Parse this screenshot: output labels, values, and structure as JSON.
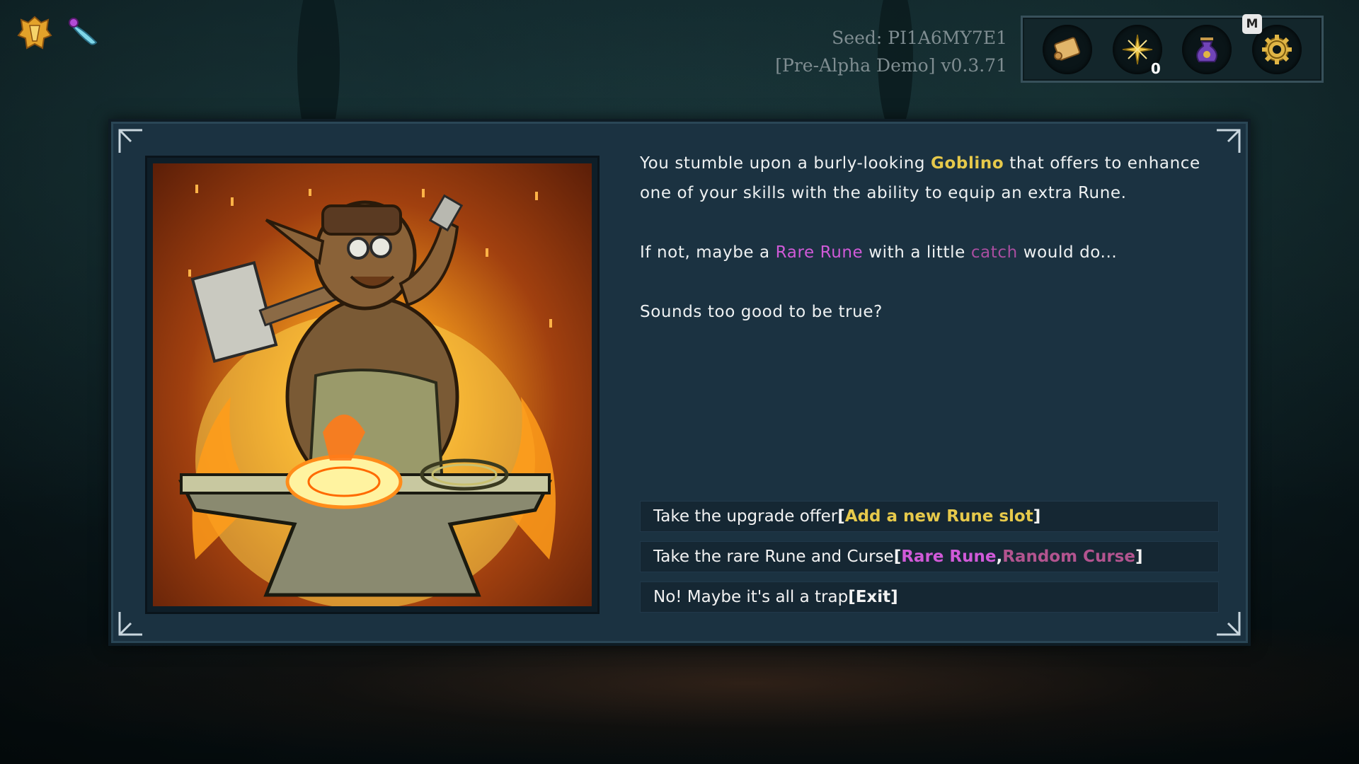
{
  "seed": {
    "seed_label": "Seed: PI1A6MY7E1",
    "version_label": "[Pre-Alpha Demo] v0.3.71"
  },
  "hud": {
    "crest_icon": "golden-crest-icon",
    "weapon_icon": "spirit-dagger-icon"
  },
  "top_menu": {
    "items": [
      {
        "name": "map-scroll-icon"
      },
      {
        "name": "star-points-icon",
        "count": "0"
      },
      {
        "name": "loot-bag-icon"
      },
      {
        "name": "settings-gear-icon"
      }
    ],
    "hotkey": "M"
  },
  "event": {
    "paragraph1": {
      "pre": "You stumble upon a burly-looking ",
      "name": "Goblino",
      "post": " that offers to enhance one of your skills with the ability to equip an extra Rune."
    },
    "paragraph2": {
      "pre": "If not, maybe a ",
      "rare": "Rare Rune",
      "mid": " with a little ",
      "catch": "catch",
      "post": " would do..."
    },
    "paragraph3": "Sounds too good to be true?"
  },
  "choices": [
    {
      "text": "Take the upgrade offer ",
      "open": "[",
      "reward": "Add a new Rune slot",
      "close": "]"
    },
    {
      "text": "Take the rare Rune and Curse ",
      "open": "[",
      "reward1": "Rare Rune",
      "sep": ", ",
      "reward2": "Random Curse",
      "close": "]"
    },
    {
      "text": "No! Maybe it's all a trap ",
      "label": "[Exit]"
    }
  ],
  "colors": {
    "gold_highlight": "#e6c94b",
    "rare_highlight": "#d05ad8",
    "curse_highlight": "#a94ea0",
    "panel_bg": "#1b3241"
  }
}
